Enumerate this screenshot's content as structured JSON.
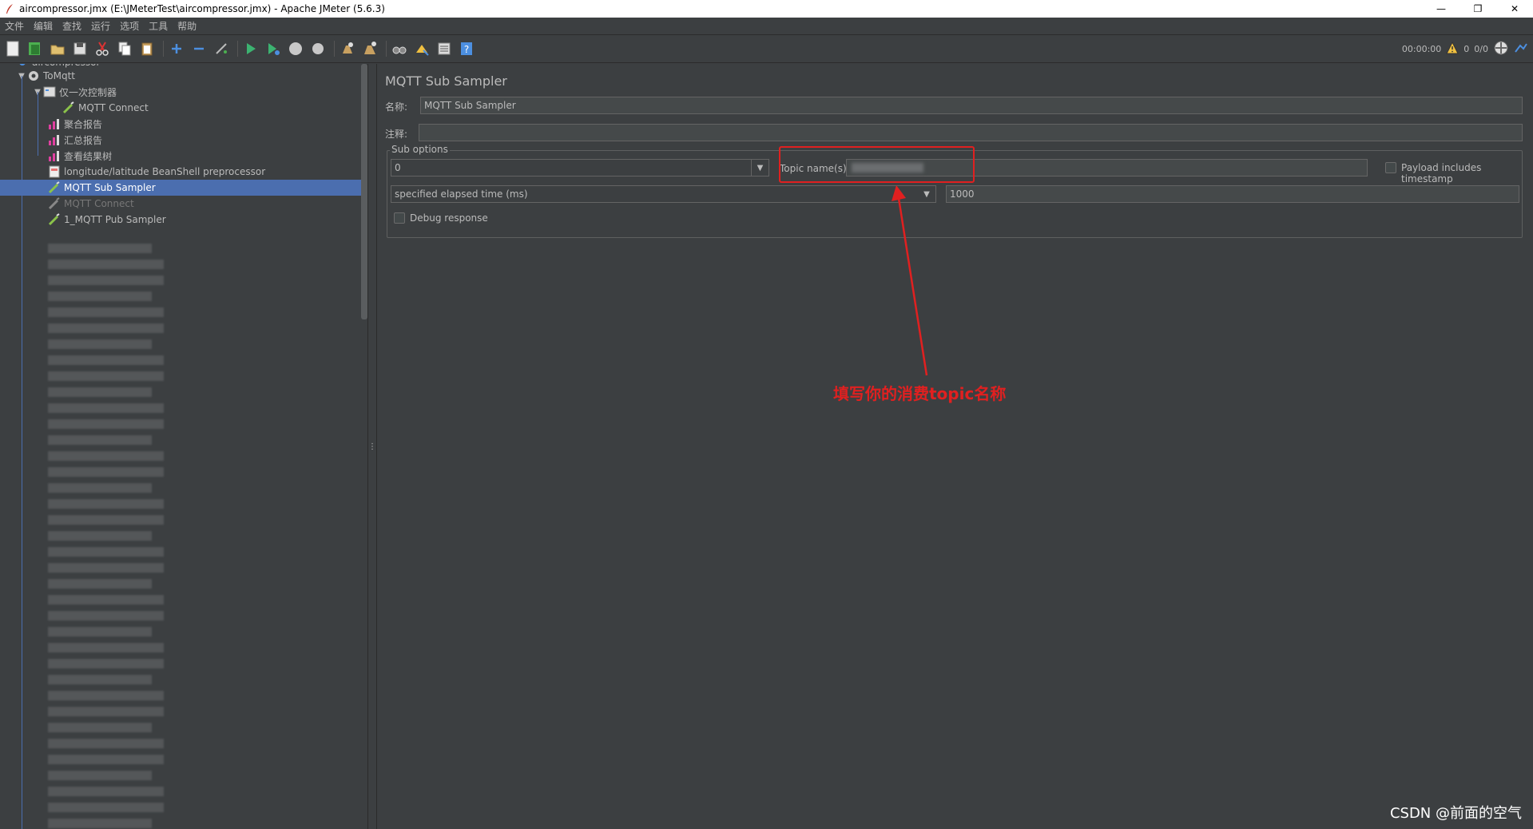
{
  "window": {
    "title": "aircompressor.jmx (E:\\JMeterTest\\aircompressor.jmx) - Apache JMeter (5.6.3)",
    "minimize": "—",
    "restore": "❐",
    "close": "✕"
  },
  "menu": [
    "文件",
    "编辑",
    "查找",
    "运行",
    "选项",
    "工具",
    "帮助"
  ],
  "toolbar_status": {
    "timer": "00:00:00",
    "warnings": "0",
    "threads": "0/0"
  },
  "tree": {
    "root_partial": "aircompressor",
    "items": [
      {
        "label": "ToMqtt",
        "icon": "gear-icon"
      },
      {
        "label": "仅一次控制器",
        "icon": "controller-icon"
      },
      {
        "label": "MQTT Connect",
        "icon": "sampler-pipette-icon"
      },
      {
        "label": "聚合报告",
        "icon": "report-chart-icon"
      },
      {
        "label": "汇总报告",
        "icon": "report-chart-icon"
      },
      {
        "label": "查看结果树",
        "icon": "report-chart-icon"
      },
      {
        "label": "longitude/latitude BeanShell preprocessor",
        "icon": "preprocessor-icon"
      },
      {
        "label": "MQTT Sub Sampler",
        "icon": "sampler-pipette-icon"
      },
      {
        "label": "MQTT Connect",
        "icon": "sampler-pipette-icon"
      },
      {
        "label": "1_MQTT Pub Sampler",
        "icon": "sampler-pipette-icon"
      }
    ]
  },
  "panel": {
    "title": "MQTT Sub Sampler",
    "name_label": "名称:",
    "name_value": "MQTT Sub Sampler",
    "comment_label": "注释:",
    "comment_value": "",
    "sub_options_legend": "Sub options",
    "qos_value": "0",
    "topic_label": "Topic name(s):",
    "topic_value": "",
    "payload_timestamp_label": "Payload includes timestamp",
    "sample_on_value": "specified elapsed time (ms)",
    "elapsed_value": "1000",
    "debug_response_label": "Debug response"
  },
  "annotation": {
    "text": "填写你的消费topic名称",
    "color": "#e02020"
  },
  "watermark": "CSDN @前面的空气"
}
